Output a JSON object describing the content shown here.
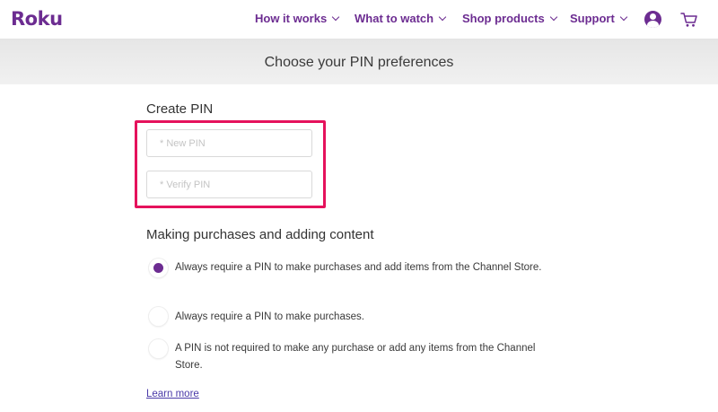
{
  "header": {
    "logo": "Roku",
    "nav": [
      {
        "label": "How it works"
      },
      {
        "label": "What to watch"
      },
      {
        "label": "Shop products"
      },
      {
        "label": "Support"
      }
    ],
    "account_icon": "account-icon",
    "cart_icon": "cart-icon"
  },
  "banner": {
    "title": "Choose your PIN preferences"
  },
  "create_pin": {
    "title": "Create PIN",
    "new_pin_placeholder": "* New PIN",
    "verify_pin_placeholder": "* Verify PIN"
  },
  "purchases": {
    "title": "Making purchases and adding content",
    "options": [
      {
        "label": "Always require a PIN to make purchases and add items from the Channel Store.",
        "selected": true
      },
      {
        "label": "Always require a PIN to make purchases.",
        "selected": false
      },
      {
        "label": "A PIN is not required to make any purchase or add any items from the Channel Store.",
        "selected": false
      }
    ]
  },
  "learn_more": "Learn more",
  "colors": {
    "brand_purple": "#6c2c91",
    "highlight": "#e5125c",
    "link": "#4a3aa8"
  }
}
